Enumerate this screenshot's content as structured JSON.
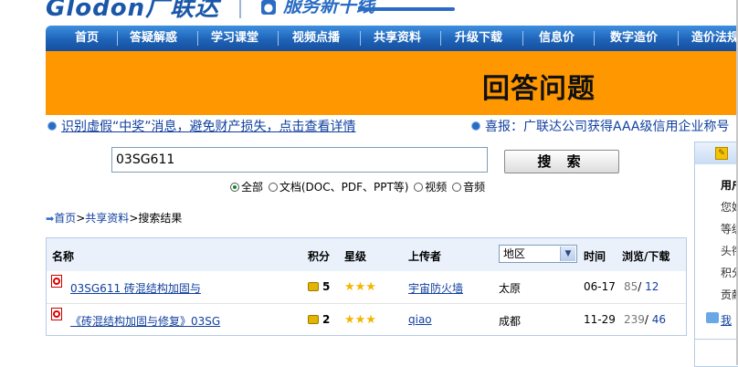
{
  "header": {
    "logo_text": "Glodon广联达",
    "slogan": "服务新干线",
    "slogan_icon": "service-badge-icon"
  },
  "nav": {
    "items": [
      "首页",
      "答疑解惑",
      "学习课堂",
      "视频点播",
      "共享资料",
      "升级下载",
      "信息价",
      "数字造价",
      "造价法规"
    ]
  },
  "banner": {
    "title": "回答问题"
  },
  "notices": [
    {
      "text": "识别虚假“中奖”消息，避免财产损失，点击查看详情"
    },
    {
      "text": "喜报：广联达公司获得AAA级信用企业称号"
    }
  ],
  "search": {
    "value": "03SG611",
    "button": "搜 索",
    "options": [
      {
        "label": "全部",
        "selected": true
      },
      {
        "label": "文档(DOC、PDF、PPT等)",
        "selected": false
      },
      {
        "label": "视频",
        "selected": false
      },
      {
        "label": "音频",
        "selected": false
      }
    ]
  },
  "breadcrumb": {
    "home": "首页",
    "section": "共享资料",
    "current": "搜索结果"
  },
  "table": {
    "headers": {
      "name": "名称",
      "points": "积分",
      "rating": "星级",
      "uploader": "上传者",
      "region": "地区",
      "time": "时间",
      "views_downloads": "浏览/下载"
    },
    "rows": [
      {
        "title": "03SG611 砖混结构加固与",
        "points": "5",
        "stars": "★★★",
        "uploader": "宇宙防火墙",
        "region": "太原",
        "time": "06-17",
        "views": "85",
        "downloads": "12"
      },
      {
        "title": "《砖混结构加固与修复》03SG",
        "points": "2",
        "stars": "★★★",
        "uploader": "qiao",
        "region": "成都",
        "time": "11-29",
        "views": "239",
        "downloads": "46"
      }
    ]
  },
  "right_panel": {
    "lines": [
      "用户",
      "您好",
      "等级",
      "头衔",
      "积分",
      "贡献"
    ],
    "link": "我"
  },
  "colors": {
    "nav_blue": "#1e63b8",
    "banner_orange": "#ff9800",
    "link_blue": "#1140a0"
  }
}
